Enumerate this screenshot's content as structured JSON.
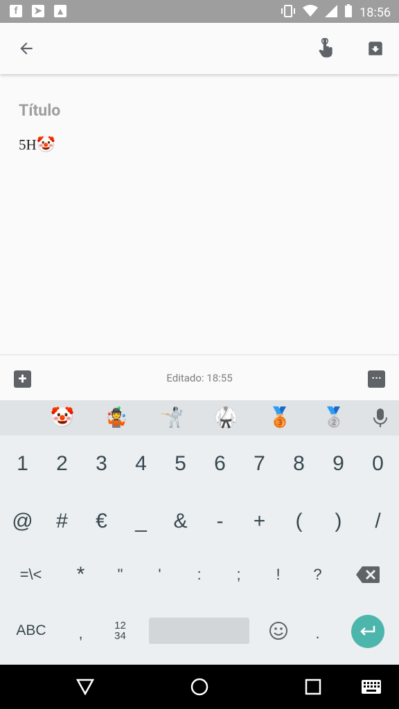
{
  "status_bar": {
    "time": "18:56"
  },
  "toolbar": {
    "back_icon": "arrow-back-icon",
    "touch_icon": "touch-hand-icon",
    "archive_icon": "archive-icon"
  },
  "note": {
    "title_placeholder": "Título",
    "body_text": "5H",
    "body_emoji": "🤡"
  },
  "bottom_bar": {
    "edited_text": "Editado: 18:55"
  },
  "emoji_suggestions": [
    "🤡",
    "🤹",
    "🤺",
    "🥋",
    "🥉",
    "🥈"
  ],
  "keyboard": {
    "row1": [
      "1",
      "2",
      "3",
      "4",
      "5",
      "6",
      "7",
      "8",
      "9",
      "0"
    ],
    "row2": [
      "@",
      "#",
      "€",
      "_",
      "&",
      "-",
      "+",
      "(",
      ")",
      "/"
    ],
    "row3": [
      "=\\<",
      "*",
      "\"",
      "'",
      ":",
      ";",
      "!",
      "?"
    ],
    "row4": {
      "abc": "ABC",
      "comma": ",",
      "numpad": "12\n34",
      "period": "."
    }
  },
  "colors": {
    "enter_key": "#4db6ac",
    "status_bar": "#9e9e9e"
  }
}
